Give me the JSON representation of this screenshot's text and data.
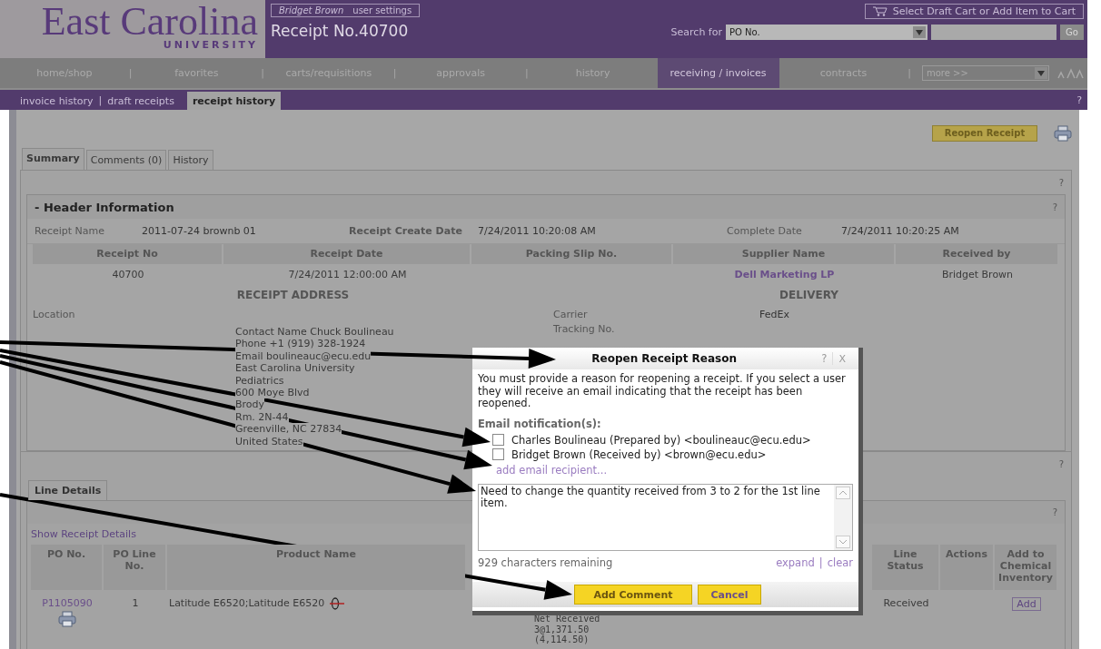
{
  "header": {
    "logo": "East Carolina",
    "logo_sub": "UNIVERSITY",
    "user_name": "Bridget Brown",
    "user_settings": "user settings",
    "page_title": "Receipt No.40700",
    "cart_button": "Select Draft Cart or Add Item to Cart",
    "search_label": "Search for",
    "search_type": "PO No.",
    "go_button": "Go"
  },
  "nav": {
    "separator": "|",
    "items": [
      {
        "label": "home/shop",
        "selected": false
      },
      {
        "label": "favorites",
        "selected": false
      },
      {
        "label": "carts/requisitions",
        "selected": false
      },
      {
        "label": "approvals",
        "selected": false
      },
      {
        "label": "history",
        "selected": false
      },
      {
        "label": "receiving / invoices",
        "selected": true
      },
      {
        "label": "contracts",
        "selected": false
      }
    ],
    "more_select": "more >>"
  },
  "subnav": {
    "separator": "|",
    "items": [
      {
        "label": "invoice history",
        "selected": false
      },
      {
        "label": "draft receipts",
        "selected": false
      },
      {
        "label": "receipt history",
        "selected": true
      }
    ],
    "help": "?"
  },
  "reopen_button": "Reopen Receipt",
  "tabs": [
    {
      "label": "Summary",
      "selected": true
    },
    {
      "label": "Comments (0)",
      "selected": false
    },
    {
      "label": "History",
      "selected": false
    }
  ],
  "summary_help": "?",
  "header_info": {
    "title": "- Header Information",
    "help": "?",
    "fields": [
      {
        "label": "Receipt Name",
        "value": "2011-07-24 brownb 01"
      },
      {
        "label": "Receipt Create Date",
        "value": "7/24/2011 10:20:08 AM"
      },
      {
        "label": "Complete Date",
        "value": "7/24/2011 10:20:25 AM"
      }
    ],
    "columns": [
      "Receipt No",
      "Receipt Date",
      "Packing Slip No.",
      "Supplier Name",
      "Received by"
    ],
    "row": {
      "receipt_no": "40700",
      "receipt_date": "7/24/2011 12:00:00 AM",
      "supplier": "Dell Marketing LP",
      "received_by": "Bridget Brown"
    }
  },
  "receipt_address": {
    "title": "RECEIPT ADDRESS",
    "location_label": "Location",
    "lines": [
      "Contact Name Chuck Boulineau",
      "Phone +1 (919) 328-1924",
      "Email boulineauc@ecu.edu",
      "East Carolina University",
      "Pediatrics",
      "600 Moye Blvd",
      "Brody",
      "Rm. 2N-44",
      "Greenville, NC 27834",
      "United States"
    ]
  },
  "delivery": {
    "title": "DELIVERY",
    "fields": [
      {
        "label": "Carrier",
        "value": "FedEx"
      },
      {
        "label": "Tracking No."
      }
    ]
  },
  "lines_help": "?",
  "line_details": {
    "tab": "Line Details",
    "help": "?",
    "show_link": "Show Receipt Details",
    "columns": [
      "PO No.",
      "PO Line No.",
      "Product Name",
      "Line Status",
      "Actions",
      "Add to Chemical Inventory"
    ],
    "rows": [
      {
        "po": "P1105090",
        "line": "1",
        "product": "Latitude E6520;Latitude E6520",
        "net": [
          "Net Received",
          "3@1,371.50",
          "(4,114.50)"
        ],
        "status": "Received",
        "add": "Add"
      }
    ]
  },
  "dialog": {
    "title": "Reopen Receipt Reason",
    "help": "?",
    "close": "X",
    "message": "You must provide a reason for reopening a receipt. If you select a user they will receive an email indicating that the receipt has been reopened.",
    "recipients_label": "Email notification(s):",
    "recipients": [
      {
        "label": "Charles Boulineau (Prepared by) <boulineauc@ecu.edu>",
        "checked": false
      },
      {
        "label": "Bridget Brown (Received by) <brown@ecu.edu>",
        "checked": false
      }
    ],
    "add_recipient": "add email recipient...",
    "comment": "Need to change the quantity received from 3 to 2 for the 1st line item.",
    "remaining": "929 characters remaining",
    "expand": "expand",
    "link_separator": "|",
    "clear": "clear",
    "buttons": [
      "Add Comment",
      "Cancel"
    ]
  }
}
